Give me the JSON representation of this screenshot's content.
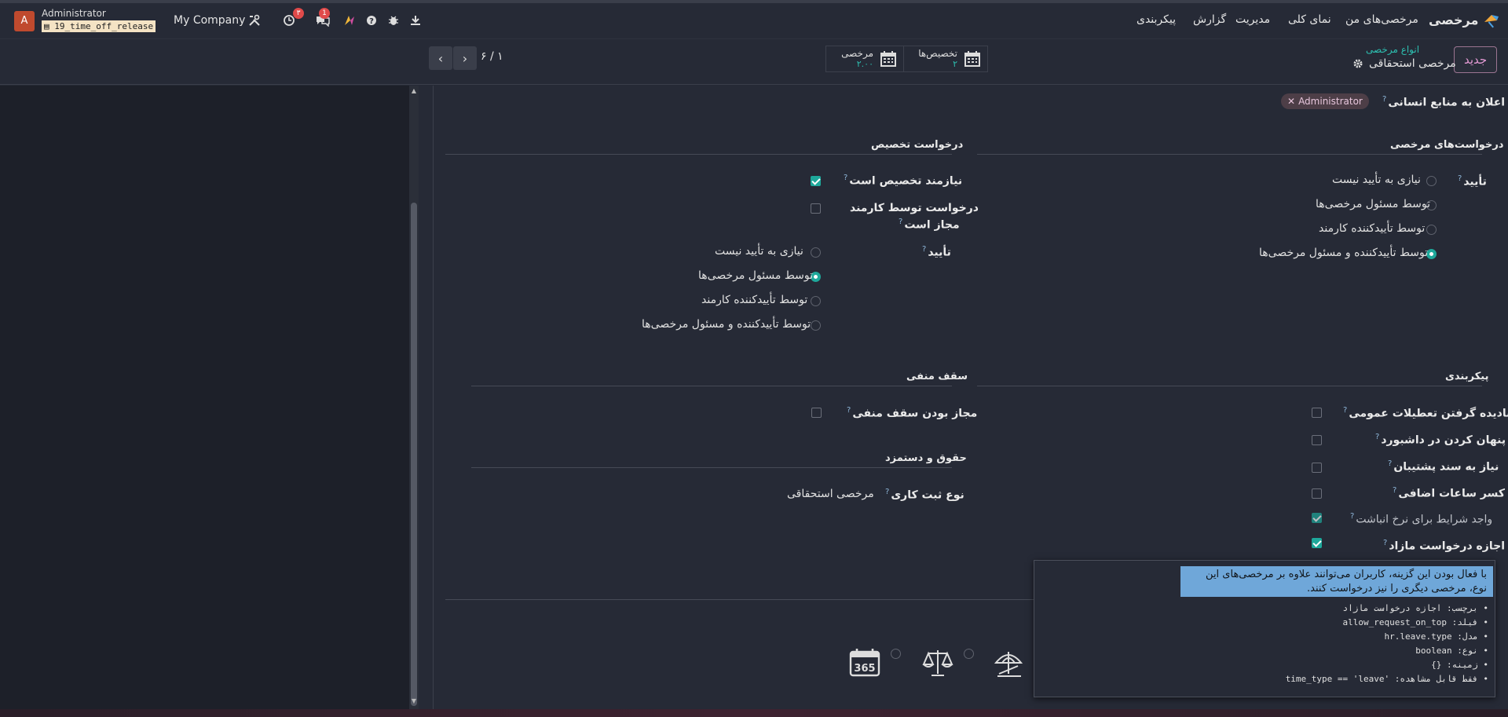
{
  "navbar": {
    "brand": "مرخصی",
    "menu": [
      "مرخصی‌های من",
      "نمای کلی",
      "مدیریت",
      "گزارش",
      "پیکربندی"
    ],
    "company": "My Company",
    "user_name": "Administrator",
    "db_name": "19_time_off_release",
    "avatar_letter": "A",
    "activity_badge": "۳",
    "messages_badge": "1"
  },
  "control": {
    "new_button": "جدید",
    "breadcrumb_parent": "انواع مرخصی",
    "breadcrumb_current": "مرخصی استحقاقی",
    "stat_allocations_label": "تخصیص‌ها",
    "stat_allocations_value": "۲",
    "stat_timeoff_label": "مرخصی",
    "stat_timeoff_value": "۲.۰۰",
    "pager": "۱ / ۶"
  },
  "form": {
    "notify_label": "اعلان به منابع انسانی",
    "notify_tag": "Administrator",
    "timeoff_requests": {
      "title": "درخواست‌های مرخصی",
      "approval_label": "تأیید",
      "options": [
        "نیازی به تأیید نیست",
        "توسط مسئول مرخصی‌ها",
        "توسط تأییدکننده کارمند",
        "توسط تأییدکننده و مسئول مرخصی‌ها"
      ],
      "selected_index": 3
    },
    "allocation_requests": {
      "title": "درخواست تخصیص",
      "requires_allocation_label": "نیازمند تخصیص است",
      "requires_allocation": true,
      "employee_request_label_1": "درخواست توسط کارمند",
      "employee_request_label_2": "مجاز است",
      "employee_request": false,
      "approval_label": "تأیید",
      "options": [
        "نیازی به تأیید نیست",
        "توسط مسئول مرخصی‌ها",
        "توسط تأییدکننده کارمند",
        "توسط تأییدکننده و مسئول مرخصی‌ها"
      ],
      "selected_index": 1
    },
    "configuration": {
      "title": "پیکربندی",
      "fields": [
        {
          "label": "نادیده گرفتن تعطیلات عمومی",
          "checked": false
        },
        {
          "label": "پنهان کردن در داشبورد",
          "checked": false
        },
        {
          "label": "نیاز به سند پشتیبان",
          "checked": false
        },
        {
          "label": "کسر ساعات اضافی",
          "checked": false
        },
        {
          "label": "واجد شرایط برای نرخ انباشت",
          "checked": true
        },
        {
          "label": "اجازه درخواست مازاد",
          "checked": true
        }
      ]
    },
    "negative_cap": {
      "title": "سقف منفی",
      "allow_label": "مجاز بودن سقف منفی",
      "allow": false
    },
    "payroll": {
      "title": "حقوق و دستمزد",
      "work_entry_label": "نوع ثبت کاری",
      "work_entry_value": "مرخصی استحقاقی"
    }
  },
  "tooltip": {
    "help": "با فعال بودن این گزینه، کاربران می‌توانند علاوه بر مرخصی‌های این نوع، مرخصی دیگری را نیز درخواست کنند.",
    "lines": [
      {
        "key": "برچسب:",
        "value": "اجازه درخواست مازاد"
      },
      {
        "key": "فیلد:",
        "value": "allow_request_on_top"
      },
      {
        "key": "مدل:",
        "value": "hr.leave.type"
      },
      {
        "key": "نوع:",
        "value": "boolean"
      },
      {
        "key": "زمینه:",
        "value": "{}"
      },
      {
        "key": "فقط قابل مشاهده:",
        "value": "'time_type == 'leave"
      }
    ]
  },
  "icons": [
    "umbrella-icon",
    "scale-icon",
    "calendar-365-icon"
  ],
  "colors": {
    "accent": "#1ea89b",
    "brand_button": "#e59bd5",
    "tooltip_help_bg": "#6fa7d9"
  }
}
